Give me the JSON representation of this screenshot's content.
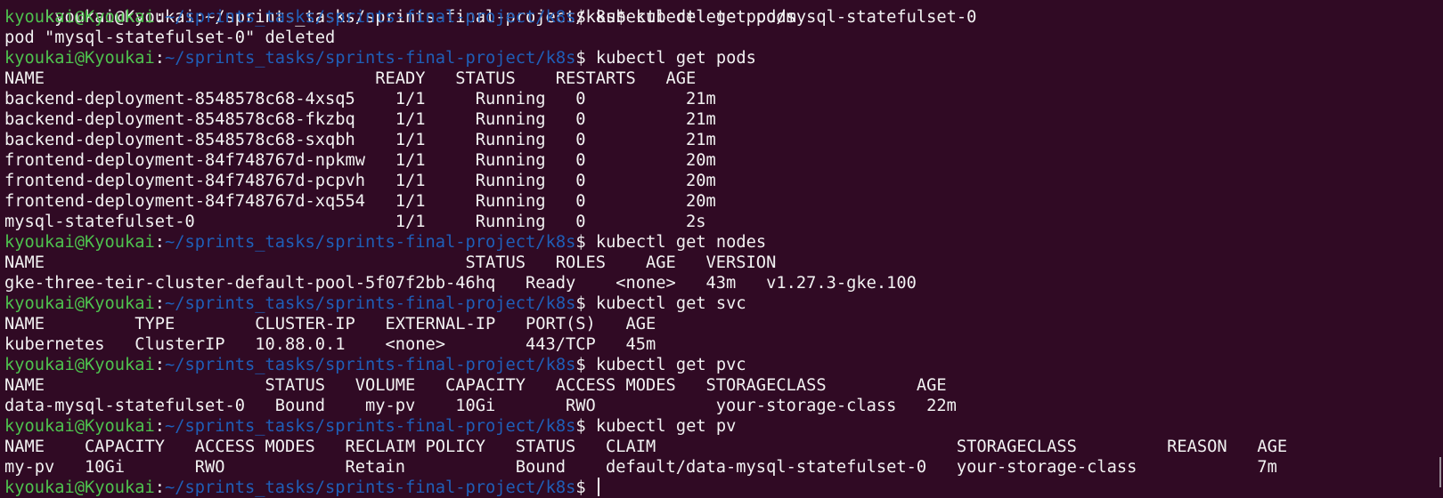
{
  "top_fragment": "kyoukai@Kyoukai:~/sprints_tasks/sprints-final-project/k8s$ kubectl get pods",
  "prompt": {
    "user_host": "kyoukai@Kyoukai",
    "colon": ":",
    "path": "~/sprints_tasks/sprints-final-project/k8s",
    "dollar": "$ "
  },
  "commands": [
    "kubectl delete pod/mysql-statefulset-0",
    "kubectl get pods",
    "kubectl get nodes",
    "kubectl get svc",
    "kubectl get pvc",
    "kubectl get pv"
  ],
  "outputs": {
    "delete": "pod \"mysql-statefulset-0\" deleted",
    "pods": {
      "header": "NAME                                 READY   STATUS    RESTARTS   AGE",
      "rows": [
        "backend-deployment-8548578c68-4xsq5    1/1     Running   0          21m",
        "backend-deployment-8548578c68-fkzbq    1/1     Running   0          21m",
        "backend-deployment-8548578c68-sxqbh    1/1     Running   0          21m",
        "frontend-deployment-84f748767d-npkmw   1/1     Running   0          20m",
        "frontend-deployment-84f748767d-pcpvh   1/1     Running   0          20m",
        "frontend-deployment-84f748767d-xq554   1/1     Running   0          20m",
        "mysql-statefulset-0                    1/1     Running   0          2s"
      ]
    },
    "nodes": {
      "header": "NAME                                          STATUS   ROLES    AGE   VERSION",
      "rows": [
        "gke-three-teir-cluster-default-pool-5f07f2bb-46hq   Ready    <none>   43m   v1.27.3-gke.100"
      ]
    },
    "svc": {
      "header": "NAME         TYPE        CLUSTER-IP   EXTERNAL-IP   PORT(S)   AGE",
      "rows": [
        "kubernetes   ClusterIP   10.88.0.1    <none>        443/TCP   45m"
      ]
    },
    "pvc": {
      "header": "NAME                      STATUS   VOLUME   CAPACITY   ACCESS MODES   STORAGECLASS         AGE",
      "rows": [
        "data-mysql-statefulset-0   Bound    my-pv    10Gi       RWO            your-storage-class   22m"
      ]
    },
    "pv": {
      "header": "NAME    CAPACITY   ACCESS MODES   RECLAIM POLICY   STATUS   CLAIM                              STORAGECLASS         REASON   AGE",
      "rows": [
        "my-pv   10Gi       RWO            Retain           Bound    default/data-mysql-statefulset-0   your-storage-class            7m"
      ]
    }
  },
  "colors": {
    "background": "#300a24",
    "user_host": "#4ec24e",
    "path": "#1f5fb8",
    "text": "#f2f2f2"
  }
}
